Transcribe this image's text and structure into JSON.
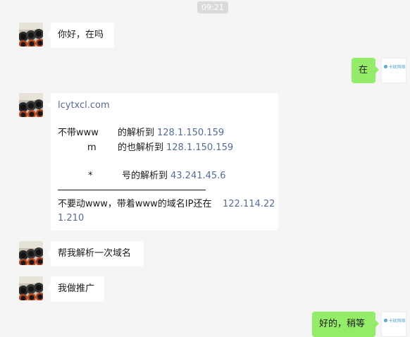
{
  "timestamp": "09:21",
  "self_avatar_brand": "卡硕网络",
  "messages": {
    "m1": "你好，在吗",
    "m2": "在",
    "m3": {
      "domain": "lcytxcl.com",
      "l1_a": "不带www",
      "l1_b": "的解析到",
      "l1_ip": "128.1.150.159",
      "l2_a": "m",
      "l2_b": "的也解析到",
      "l2_ip": "128.1.150.159",
      "l3_a": "*",
      "l3_b": "号的解析到",
      "l3_ip": "43.241.45.6",
      "l4_a": "不要动www，带着www的域名IP还在",
      "l4_ip1": "122.114.22",
      "l4_ip2": "1.210"
    },
    "m4": "帮我解析一次域名",
    "m5": "我做推广",
    "m6": "好的，稍等"
  }
}
